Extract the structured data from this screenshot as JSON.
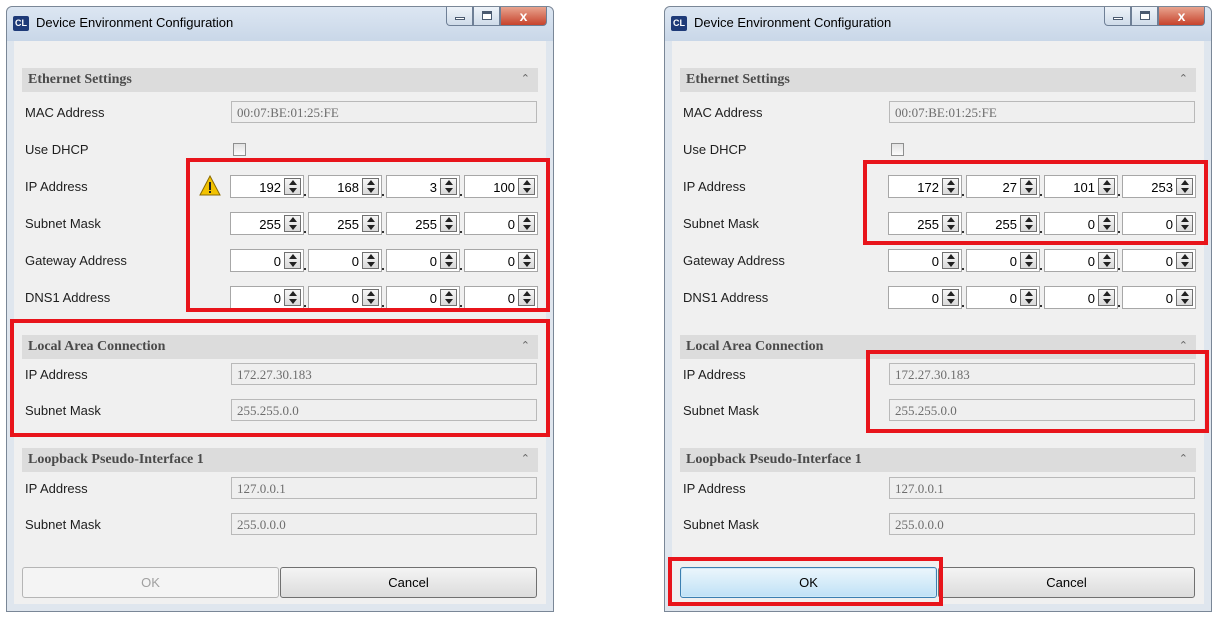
{
  "dialogs": [
    {
      "title": "Device Environment Configuration",
      "app_icon_text": "CL",
      "ethernet": {
        "header": "Ethernet Settings",
        "mac_label": "MAC Address",
        "mac_value": "00:07:BE:01:25:FE",
        "dhcp_label": "Use DHCP",
        "dhcp_checked": false,
        "ip_label": "IP Address",
        "ip": [
          "192",
          "168",
          "3",
          "100"
        ],
        "subnet_label": "Subnet Mask",
        "subnet": [
          "255",
          "255",
          "255",
          "0"
        ],
        "gateway_label": "Gateway Address",
        "gateway": [
          "0",
          "0",
          "0",
          "0"
        ],
        "dns_label": "DNS1 Address",
        "dns": [
          "0",
          "0",
          "0",
          "0"
        ],
        "warning_icon": "warning-icon"
      },
      "local_area": {
        "header": "Local Area Connection",
        "ip_label": "IP Address",
        "ip_value": "172.27.30.183",
        "subnet_label": "Subnet Mask",
        "subnet_value": "255.255.0.0"
      },
      "loopback": {
        "header": "Loopback Pseudo-Interface 1",
        "ip_label": "IP Address",
        "ip_value": "127.0.0.1",
        "subnet_label": "Subnet Mask",
        "subnet_value": "255.0.0.0"
      },
      "ok_label": "OK",
      "ok_state": "disabled",
      "cancel_label": "Cancel"
    },
    {
      "title": "Device Environment Configuration",
      "app_icon_text": "CL",
      "ethernet": {
        "header": "Ethernet Settings",
        "mac_label": "MAC Address",
        "mac_value": "00:07:BE:01:25:FE",
        "dhcp_label": "Use DHCP",
        "dhcp_checked": false,
        "ip_label": "IP Address",
        "ip": [
          "172",
          "27",
          "101",
          "253"
        ],
        "subnet_label": "Subnet Mask",
        "subnet": [
          "255",
          "255",
          "0",
          "0"
        ],
        "gateway_label": "Gateway Address",
        "gateway": [
          "0",
          "0",
          "0",
          "0"
        ],
        "dns_label": "DNS1 Address",
        "dns": [
          "0",
          "0",
          "0",
          "0"
        ]
      },
      "local_area": {
        "header": "Local Area Connection",
        "ip_label": "IP Address",
        "ip_value": "172.27.30.183",
        "subnet_label": "Subnet Mask",
        "subnet_value": "255.255.0.0"
      },
      "loopback": {
        "header": "Loopback Pseudo-Interface 1",
        "ip_label": "IP Address",
        "ip_value": "127.0.0.1",
        "subnet_label": "Subnet Mask",
        "subnet_value": "255.0.0.0"
      },
      "ok_label": "OK",
      "ok_state": "enabled",
      "cancel_label": "Cancel"
    }
  ],
  "colors": {
    "highlight": "#e8141b",
    "window_frame": "#dfe6ee",
    "section_header": "#dcdcdc"
  }
}
